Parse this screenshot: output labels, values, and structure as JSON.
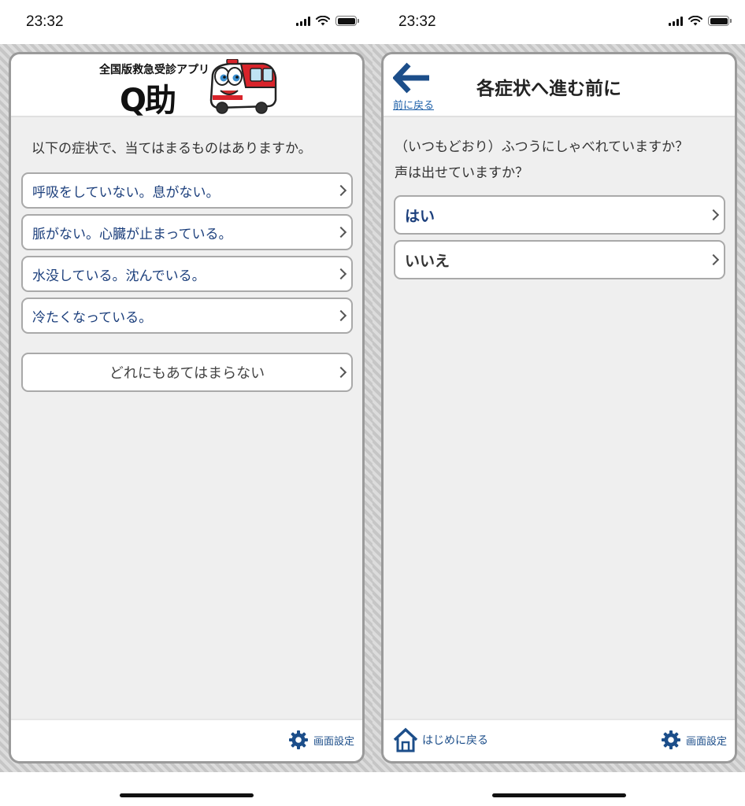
{
  "status": {
    "time": "23:32"
  },
  "left": {
    "logo": {
      "subtitle": "全国版救急受診アプリ",
      "title": "Q助"
    },
    "question": "以下の症状で、当てはまるものはありますか。",
    "options": [
      {
        "label": "呼吸をしていない。息がない。"
      },
      {
        "label": "脈がない。心臓が止まっている。"
      },
      {
        "label": "水没している。沈んでいる。"
      },
      {
        "label": "冷たくなっている。"
      }
    ],
    "none_option": "どれにもあてはまらない",
    "footer": {
      "settings_label": "画面設定"
    }
  },
  "right": {
    "header": {
      "back_label": "前に戻る",
      "title": "各症状へ進む前に"
    },
    "question": "（いつもどおり）ふつうにしゃべれていますか？声は出せていますか？",
    "question_line1": "（いつもどおり）ふつうにしゃべれていますか？",
    "question_line2": "声は出せていますか？",
    "options": [
      {
        "label": "はい"
      },
      {
        "label": "いいえ"
      }
    ],
    "footer": {
      "home_label": "はじめに戻る",
      "settings_label": "画面設定"
    }
  },
  "colors": {
    "accent": "#1c3f7c",
    "link": "#1c5fa8",
    "border": "#a9a9a9",
    "background": "#efefef"
  },
  "icons": [
    "signal-icon",
    "wifi-icon",
    "battery-icon",
    "gear-icon",
    "home-icon",
    "back-arrow-icon",
    "chevron-right-icon",
    "ambulance-mascot"
  ]
}
